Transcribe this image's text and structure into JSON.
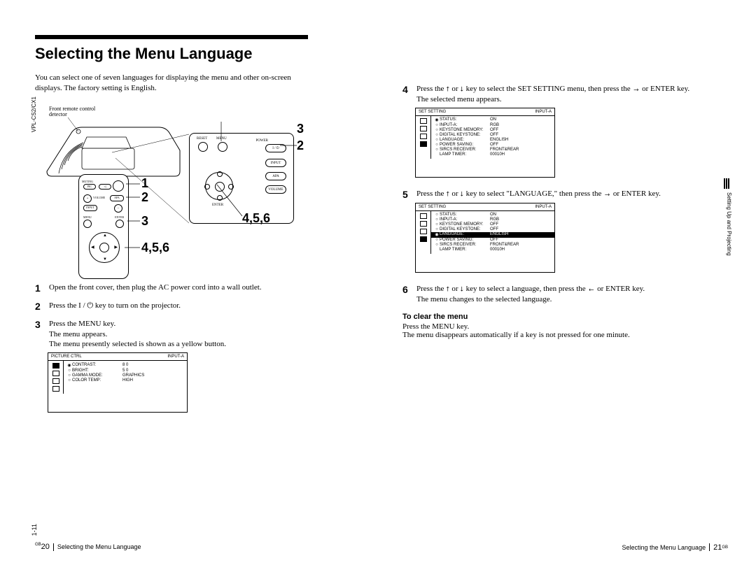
{
  "meta": {
    "model": "VPL-CS2/CX1",
    "internal_page": "1-11",
    "section_tab": "Setting Up and Projecting"
  },
  "left": {
    "title": "Selecting the Menu Language",
    "intro": "You can select one of seven languages for displaying the menu and other on-screen displays. The factory setting is English.",
    "diagram": {
      "front_remote_label": "Front remote control\ndetector",
      "panel_labels": {
        "reset": "RESET",
        "menu": "MENU",
        "power": "POWER",
        "input": "INPUT",
        "apa": "APA",
        "volume": "VOLUME",
        "enter": "ENTER"
      },
      "remote_labels": {
        "muting": "MUTING",
        "pic": "PIC",
        "audio_sym": "◁",
        "plus": "+",
        "volume": "VOLUME",
        "apa": "APA",
        "input": "INPUT",
        "minus": "–",
        "menu": "MENU",
        "enter": "ENTER"
      },
      "callouts": {
        "remote_row1": "1",
        "remote_row2": "2",
        "remote_row3": "3",
        "remote_dpad": "4,5,6",
        "panel_top": "3",
        "panel_right": "2",
        "panel_456": "4,5,6"
      }
    },
    "steps": [
      {
        "n": "1",
        "body": "Open the front cover, then plug the AC power cord into a wall outlet."
      },
      {
        "n": "2",
        "body_pre": "Press the ",
        "body_post": " key to turn on the projector.",
        "insert": "power"
      },
      {
        "n": "3",
        "body": "Press the MENU key.",
        "after_line1": "The menu appears.",
        "after_line2": "The menu presently selected is shown as a yellow button."
      }
    ],
    "osd_picture": {
      "header": "PICTURE CTRL",
      "input": "INPUT-A",
      "rows": [
        {
          "bullet": "◉",
          "key": "CONTRAST:",
          "val": "8 0"
        },
        {
          "bullet": "○",
          "key": "BRIGHT:",
          "val": "5 0"
        },
        {
          "bullet": "○",
          "key": "GAMMA MODE:",
          "val": "GRAPHICS"
        },
        {
          "bullet": "○",
          "key": "COLOR TEMP:",
          "val": "HIGH"
        }
      ]
    },
    "footer": {
      "pg": "20",
      "sup": "GB",
      "text": "Selecting the Menu Language"
    }
  },
  "right": {
    "step4": {
      "n": "4",
      "text_pre": "Press the ",
      "text_mid": " or ",
      "text_mid2": " key to select the SET SETTING menu, then press the ",
      "text_post": " or ENTER key.",
      "after": "The selected menu appears."
    },
    "osd_set1": {
      "header": "SET SETTING",
      "input": "INPUT-A",
      "rows": [
        {
          "bullet": "◉",
          "key": "STATUS:",
          "val": "ON"
        },
        {
          "bullet": "○",
          "key": "INPUT-A:",
          "val": "RGB"
        },
        {
          "bullet": "○",
          "key": "KEYSTONE MEMORY:",
          "val": "OFF"
        },
        {
          "bullet": "○",
          "key": "DIGITAL KEYSTONE:",
          "val": "OFF"
        },
        {
          "bullet": "○",
          "key": "LANGUAGE:",
          "val": "ENGLISH"
        },
        {
          "bullet": "○",
          "key": "POWER SAVING:",
          "val": "OFF"
        },
        {
          "bullet": "○",
          "key": "SIRCS RECEIVER:",
          "val": "FRONT&REAR"
        },
        {
          "bullet": "",
          "key": "LAMP TIMER:",
          "val": "00010H"
        }
      ]
    },
    "step5": {
      "n": "5",
      "text_pre": "Press the ",
      "text_mid": " or ",
      "text_mid2": " key to select \"LANGUAGE,\" then press the ",
      "text_post": " or ENTER key."
    },
    "osd_set2": {
      "header": "SET SETTING",
      "input": "INPUT-A",
      "rows": [
        {
          "bullet": "○",
          "key": "STATUS:",
          "val": "ON"
        },
        {
          "bullet": "○",
          "key": "INPUT-A:",
          "val": "RGB"
        },
        {
          "bullet": "○",
          "key": "KEYSTONE MEMORY:",
          "val": "OFF"
        },
        {
          "bullet": "○",
          "key": "DIGITAL KEYSTONE:",
          "val": "OFF"
        },
        {
          "bullet": "◉",
          "key": "LANGUAGE:",
          "val": "ENGLISH",
          "sel": true
        },
        {
          "bullet": "○",
          "key": "POWER SAVING:",
          "val": "OFF"
        },
        {
          "bullet": "○",
          "key": "SIRCS RECEIVER:",
          "val": "FRONT&REAR"
        },
        {
          "bullet": "",
          "key": "LAMP TIMER:",
          "val": "00010H"
        }
      ]
    },
    "step6": {
      "n": "6",
      "text_pre": "Press the ",
      "text_mid": " or ",
      "text_mid2": " key to select a language, then press the ",
      "text_post": " or ENTER key.",
      "after": "The menu changes to the selected language."
    },
    "clear": {
      "heading": "To clear the menu",
      "line1": "Press the MENU key.",
      "line2": "The menu disappears automatically if a key is not pressed for one minute."
    },
    "footer": {
      "text": "Selecting the Menu Language",
      "pg": "21",
      "sup": "GB"
    }
  }
}
